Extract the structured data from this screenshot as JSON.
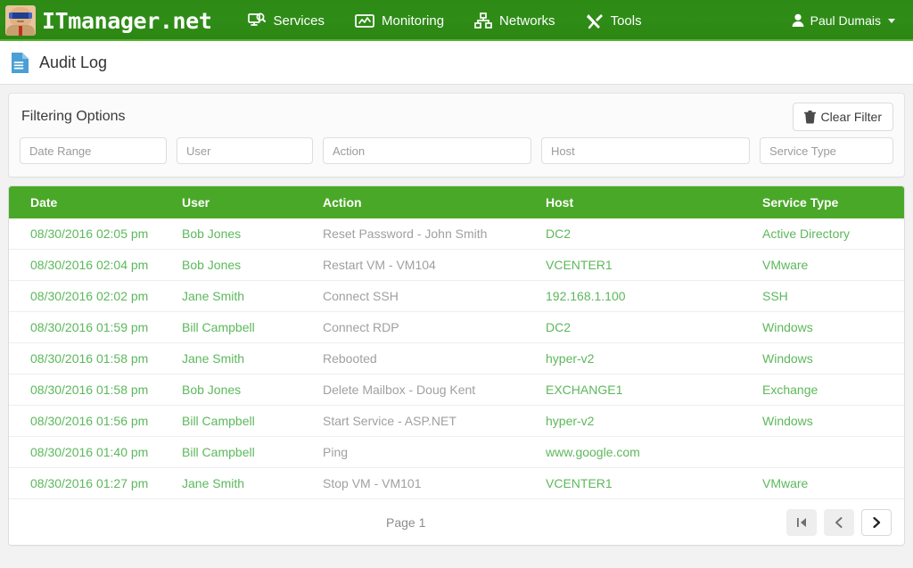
{
  "nav": {
    "brand": "ITmanager.net",
    "items": [
      {
        "label": "Services",
        "icon": "monitor-search-icon"
      },
      {
        "label": "Monitoring",
        "icon": "chart-monitor-icon"
      },
      {
        "label": "Networks",
        "icon": "sitemap-icon"
      },
      {
        "label": "Tools",
        "icon": "wrench-screwdriver-icon"
      }
    ],
    "user": {
      "name": "Paul Dumais",
      "icon": "user-icon",
      "caret": "caret-down-icon"
    },
    "bar_color": "#2e8b16",
    "accent_color": "#55b02e"
  },
  "page": {
    "title": "Audit Log",
    "title_icon": "document-icon"
  },
  "filters": {
    "heading": "Filtering Options",
    "clear_label": "Clear Filter",
    "clear_icon": "trash-icon",
    "fields": [
      {
        "name": "date-range",
        "placeholder": "Date Range",
        "value": ""
      },
      {
        "name": "user",
        "placeholder": "User",
        "value": ""
      },
      {
        "name": "action",
        "placeholder": "Action",
        "value": ""
      },
      {
        "name": "host",
        "placeholder": "Host",
        "value": ""
      },
      {
        "name": "service-type",
        "placeholder": "Service Type",
        "value": ""
      }
    ]
  },
  "table": {
    "columns": [
      "Date",
      "User",
      "Action",
      "Host",
      "Service Type"
    ],
    "header_bg": "#4aa828",
    "link_color": "#5cb85c",
    "rows": [
      {
        "date": "08/30/2016 02:05 pm",
        "user": "Bob Jones",
        "action": "Reset Password - John Smith",
        "host": "DC2",
        "service": "Active Directory"
      },
      {
        "date": "08/30/2016 02:04 pm",
        "user": "Bob Jones",
        "action": "Restart VM - VM104",
        "host": "VCENTER1",
        "service": "VMware"
      },
      {
        "date": "08/30/2016 02:02 pm",
        "user": "Jane Smith",
        "action": "Connect SSH",
        "host": "192.168.1.100",
        "service": "SSH"
      },
      {
        "date": "08/30/2016 01:59 pm",
        "user": "Bill Campbell",
        "action": "Connect RDP",
        "host": "DC2",
        "service": "Windows"
      },
      {
        "date": "08/30/2016 01:58 pm",
        "user": "Jane Smith",
        "action": "Rebooted",
        "host": "hyper-v2",
        "service": "Windows"
      },
      {
        "date": "08/30/2016 01:58 pm",
        "user": "Bob Jones",
        "action": "Delete Mailbox - Doug Kent",
        "host": "EXCHANGE1",
        "service": "Exchange"
      },
      {
        "date": "08/30/2016 01:56 pm",
        "user": "Bill Campbell",
        "action": "Start Service - ASP.NET",
        "host": "hyper-v2",
        "service": "Windows"
      },
      {
        "date": "08/30/2016 01:40 pm",
        "user": "Bill Campbell",
        "action": "Ping",
        "host": "www.google.com",
        "service": ""
      },
      {
        "date": "08/30/2016 01:27 pm",
        "user": "Jane Smith",
        "action": "Stop VM - VM101",
        "host": "VCENTER1",
        "service": "VMware"
      }
    ]
  },
  "pager": {
    "page_label": "Page 1",
    "first_icon": "first-page-icon",
    "prev_icon": "chevron-left-icon",
    "next_icon": "chevron-right-icon",
    "first_enabled": false,
    "prev_enabled": false,
    "next_enabled": true
  }
}
